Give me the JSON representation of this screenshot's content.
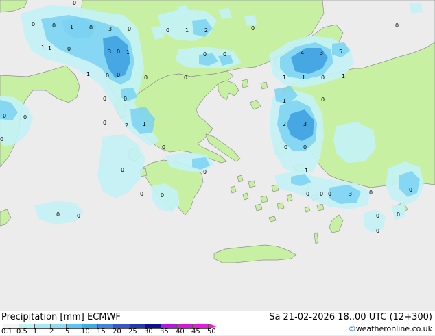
{
  "header": {
    "title": "Precipitation [mm]  ECMWF",
    "valid_time": "Sa 21-02-2026 18..00 UTC (12+300)"
  },
  "legend": {
    "labels": [
      "0.1",
      "0.5",
      "1",
      "2",
      "5",
      "10",
      "15",
      "20",
      "25",
      "30",
      "35",
      "40",
      "45",
      "50"
    ],
    "colors": [
      "#f5f5f5",
      "#bff2f2",
      "#a6e8f4",
      "#8cdcf6",
      "#5cc6f2",
      "#3aaee6",
      "#3f84dd",
      "#3557c9",
      "#2439ad",
      "#0e0e8e",
      "#b517e0",
      "#d21ad2",
      "#e81ad8",
      "#f51ad0"
    ]
  },
  "credit": {
    "icon": "copyright-icon",
    "text": "weatheronline.co.uk"
  },
  "map": {
    "colors": {
      "sea": "#ececec",
      "land": "#c8f0a3",
      "coast": "#8f8f8f",
      "precip_light": "#c3f2f6",
      "precip_mid": "#7ad2f2",
      "precip_heavy": "#3b9fe0"
    },
    "labels": [
      {
        "id": "l1",
        "text": "0"
      },
      {
        "id": "l2",
        "text": "0"
      },
      {
        "id": "l3",
        "text": "0"
      },
      {
        "id": "l4",
        "text": "0"
      },
      {
        "id": "l5",
        "text": "1"
      },
      {
        "id": "l6",
        "text": "0"
      },
      {
        "id": "l7",
        "text": "3"
      },
      {
        "id": "l8",
        "text": "0"
      },
      {
        "id": "l9",
        "text": "1"
      },
      {
        "id": "l10",
        "text": "0"
      },
      {
        "id": "l11",
        "text": "2"
      },
      {
        "id": "l12",
        "text": "1"
      },
      {
        "id": "l13",
        "text": "1"
      },
      {
        "id": "l14",
        "text": "0"
      },
      {
        "id": "l15",
        "text": "3"
      },
      {
        "id": "l16",
        "text": "0"
      },
      {
        "id": "l17",
        "text": "0"
      },
      {
        "id": "l18",
        "text": "1"
      },
      {
        "id": "l19",
        "text": "0"
      },
      {
        "id": "l20",
        "text": "0"
      },
      {
        "id": "l21",
        "text": "0"
      },
      {
        "id": "l22",
        "text": "1"
      },
      {
        "id": "l23",
        "text": "0"
      },
      {
        "id": "l24",
        "text": "0"
      },
      {
        "id": "l25",
        "text": "0"
      },
      {
        "id": "l26",
        "text": "0"
      },
      {
        "id": "l27",
        "text": "0"
      },
      {
        "id": "l28",
        "text": "0"
      },
      {
        "id": "l29",
        "text": "0"
      },
      {
        "id": "l30",
        "text": "1"
      },
      {
        "id": "l31",
        "text": "2"
      },
      {
        "id": "l32",
        "text": "0"
      },
      {
        "id": "l33",
        "text": "0"
      },
      {
        "id": "l34",
        "text": "0"
      },
      {
        "id": "l35",
        "text": "0"
      },
      {
        "id": "l36",
        "text": "4"
      },
      {
        "id": "l37",
        "text": "3"
      },
      {
        "id": "l38",
        "text": "5"
      },
      {
        "id": "l39",
        "text": "0"
      },
      {
        "id": "l40",
        "text": "1"
      },
      {
        "id": "l41",
        "text": "1"
      },
      {
        "id": "l42",
        "text": "0"
      },
      {
        "id": "l43",
        "text": "1"
      },
      {
        "id": "l44",
        "text": "1"
      },
      {
        "id": "l45",
        "text": "0"
      },
      {
        "id": "l46",
        "text": "2"
      },
      {
        "id": "l47",
        "text": "3"
      },
      {
        "id": "l48",
        "text": "0"
      },
      {
        "id": "l49",
        "text": "0"
      },
      {
        "id": "l50",
        "text": "1"
      },
      {
        "id": "l51",
        "text": "0"
      },
      {
        "id": "l52",
        "text": "0"
      },
      {
        "id": "l53",
        "text": "0"
      },
      {
        "id": "l54",
        "text": "3"
      },
      {
        "id": "l55",
        "text": "0"
      },
      {
        "id": "l56",
        "text": "0"
      },
      {
        "id": "l57",
        "text": "0"
      },
      {
        "id": "l58",
        "text": "0"
      },
      {
        "id": "l59",
        "text": "0"
      },
      {
        "id": "l60",
        "text": "0"
      },
      {
        "id": "l61",
        "text": "0"
      },
      {
        "id": "l62",
        "text": "0"
      },
      {
        "id": "l63",
        "text": "0"
      }
    ]
  }
}
